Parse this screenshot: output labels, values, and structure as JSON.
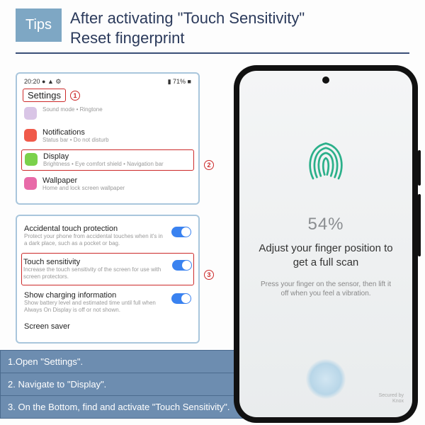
{
  "tips": {
    "badge": "Tips",
    "line1": "After activating \"Touch Sensitivity\"",
    "line2": "Reset fingerprint"
  },
  "panel1": {
    "status_left": "20:20 ● ▲ ⚙",
    "status_right": "▮ 71% ■",
    "settings_label": "Settings",
    "marker1": "1",
    "marker2": "2",
    "items": [
      {
        "title": "",
        "sub": "Sound mode • Ringtone",
        "color": "#d9c5e6"
      },
      {
        "title": "Notifications",
        "sub": "Status bar • Do not disturb",
        "color": "#f05a4a"
      },
      {
        "title": "Display",
        "sub": "Brightness • Eye comfort shield • Navigation bar",
        "color": "#7bd14b",
        "boxed": true
      },
      {
        "title": "Wallpaper",
        "sub": "Home and lock screen wallpaper",
        "color": "#e86aa8"
      }
    ]
  },
  "panel2": {
    "marker3": "3",
    "items": [
      {
        "title": "Accidental touch protection",
        "sub": "Protect your phone from accidental touches when it's in a dark place, such as a pocket or bag.",
        "toggle": true
      },
      {
        "title": "Touch sensitivity",
        "sub": "Increase the touch sensitivity of the screen for use with screen protectors.",
        "toggle": true,
        "boxed": true
      },
      {
        "title": "Show charging information",
        "sub": "Show battery level and estimated time until full when Always On Display is off or not shown.",
        "toggle": true
      },
      {
        "title": "Screen saver",
        "sub": ""
      }
    ]
  },
  "steps": [
    "1.Open \"Settings\".",
    "2. Navigate to \"Display\".",
    "3. On the Bottom, find and activate \"Touch Sensitivity\"."
  ],
  "phone": {
    "percent": "54%",
    "big": "Adjust your finger position to get a full scan",
    "small": "Press your finger on the sensor, then lift it off when you feel a vibration.",
    "knox1": "Secured by",
    "knox2": "Knox"
  }
}
